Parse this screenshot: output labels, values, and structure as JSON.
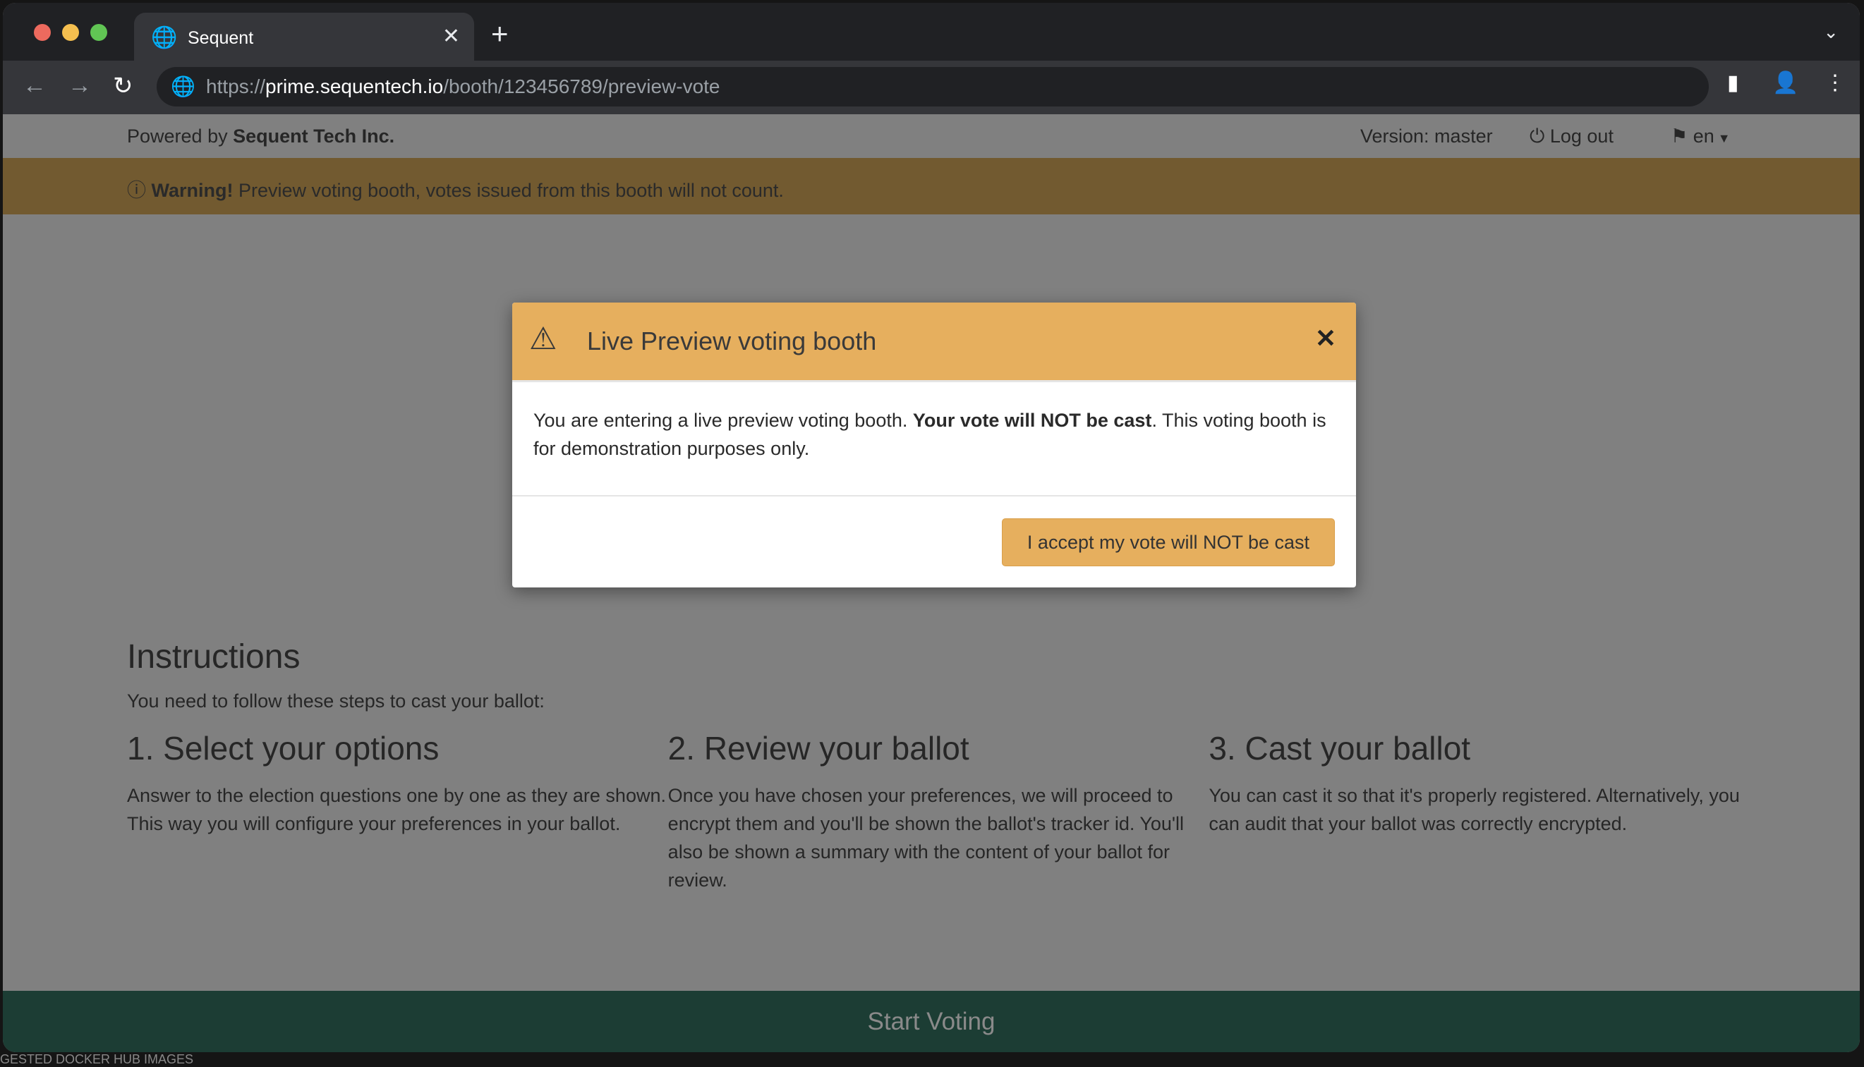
{
  "browser": {
    "tab_title": "Sequent",
    "url_scheme": "https://",
    "url_host": "prime.sequentech.io",
    "url_path": "/booth/123456789/preview-vote"
  },
  "header": {
    "powered_prefix": "Powered by ",
    "powered_company": "Sequent Tech Inc.",
    "version": "Version: master",
    "logout": "Log out",
    "language": "en"
  },
  "warning": {
    "label": "Warning!",
    "text": " Preview voting booth, votes issued from this booth will not count.",
    "color": "#725a30"
  },
  "modal": {
    "title": "Live Preview voting booth",
    "body_pre": "You are entering a live preview voting booth. ",
    "body_bold": "Your vote will NOT be cast",
    "body_post": ". This voting booth is for demonstration purposes only.",
    "accept_button": "I accept my vote will NOT be cast",
    "accent": "#e6af5e"
  },
  "instructions": {
    "title": "Instructions",
    "subtitle": "You need to follow these steps to cast your ballot:",
    "steps": [
      {
        "title": "1. Select your options",
        "text": "Answer to the election questions one by one as they are shown. This way you will configure your preferences in your ballot."
      },
      {
        "title": "2. Review your ballot",
        "text": "Once you have chosen your preferences, we will proceed to encrypt them and you'll be shown the ballot's tracker id. You'll also be shown a summary with the content of your ballot for review."
      },
      {
        "title": "3. Cast your ballot",
        "text": "You can cast it so that it's properly registered. Alternatively, you can audit that your ballot was correctly encrypted."
      }
    ]
  },
  "footer": {
    "start_voting": "Start Voting",
    "color": "#1c3d34"
  },
  "background_strip": "GESTED DOCKER HUB IMAGES"
}
